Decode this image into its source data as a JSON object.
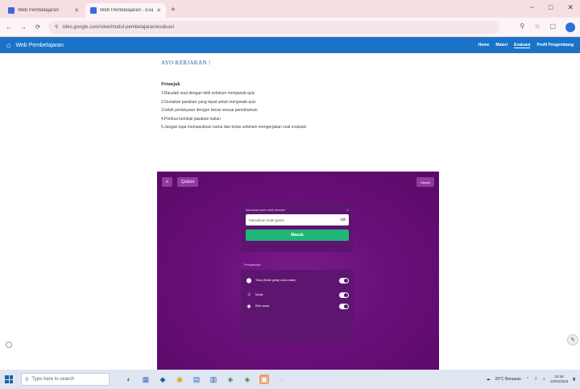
{
  "browser": {
    "tabs": [
      {
        "label": "Web Pembelajaran",
        "active": false
      },
      {
        "label": "Web Pembelajaran - Evaluasi",
        "active": true
      }
    ],
    "new_tab": "+",
    "window_controls": {
      "minimize": "−",
      "maximize": "□",
      "close": "✕"
    },
    "url": "sites.google.com/view/modul-pembelajaran/evaluasi",
    "nav": {
      "back": "←",
      "forward": "→",
      "reload": "⟳"
    }
  },
  "site": {
    "title": "Web Pembelajaran",
    "nav": [
      {
        "label": "Home",
        "active": false
      },
      {
        "label": "Materi",
        "active": false
      },
      {
        "label": "Evaluasi",
        "active": true
      },
      {
        "label": "Profil Pengembang",
        "active": false
      }
    ]
  },
  "content": {
    "heading": "AYO KERJAKAN !",
    "petunjuk_title": "Petunjuk",
    "steps": [
      "1.Bacalah soal dengan teliti sebelum menjawab quiz",
      "2.Gunakan jawaban yang tepat untuk menjawab quiz",
      "3.Isilah pertanyaan dengan benar sesuai pemahaman",
      "4.Periksa kembali jawaban kalian",
      "5.Jangan lupa memasukkan nama dan kelas sebelum mengerjakan soal evaluasi"
    ]
  },
  "quiz": {
    "menu_icon": "≡",
    "brand": "Quizizz",
    "login_label": "Masuk",
    "code_label": "Masukkan kode untuk bermain",
    "code_placeholder": "Masukkan kode game",
    "join_label": "Masuk",
    "settings_title": "Pengaturan",
    "settings": [
      {
        "icon": "⬤",
        "label": "Tema (Mode gelap untuk mata)",
        "on": true
      },
      {
        "icon": "♫",
        "label": "Musik",
        "on": true
      },
      {
        "icon": "◉",
        "label": "Efek suara",
        "on": true
      }
    ],
    "colors": {
      "bg": "#6a0f7a",
      "panel": "#5e1570",
      "accent": "#1fb67a"
    }
  },
  "taskbar": {
    "search_placeholder": "Type here to search",
    "weather": "29°C Berawan",
    "time": "10:45",
    "date": "13/02/2023",
    "apps": [
      "edge-icon",
      "file-explorer-icon",
      "chrome-icon",
      "store-icon",
      "word-icon",
      "excel-icon",
      "powerpoint-icon",
      "photos-icon"
    ]
  }
}
